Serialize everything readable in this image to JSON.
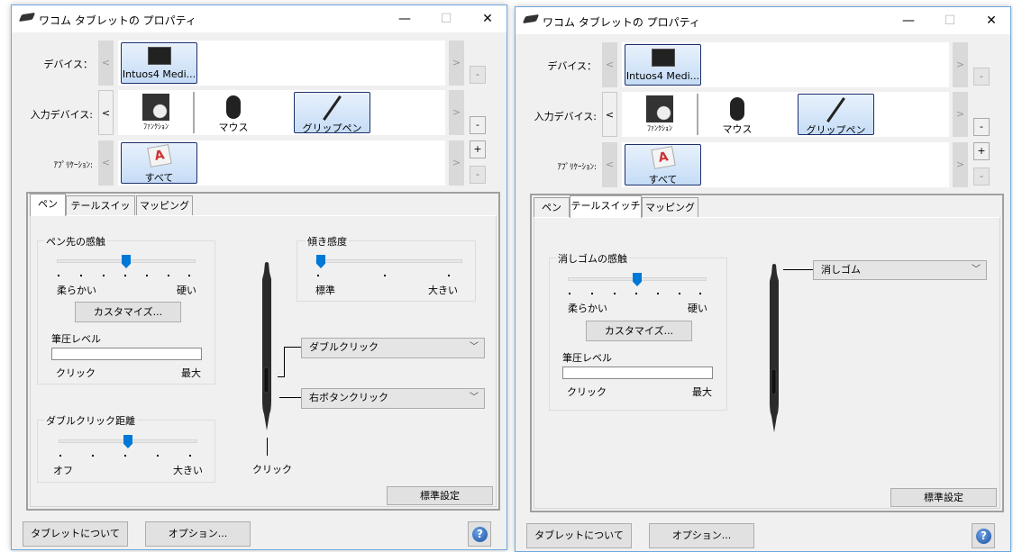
{
  "window_title": "ワコム タブレットの プロパティ",
  "window_controls": {
    "minimize": "—",
    "maximize": "☐",
    "close": "✕"
  },
  "rows": {
    "device_label": "デバイス：",
    "input_label": "入力デバイス:",
    "app_label": "ｱﾌﾟﾘｹｰｼｮﾝ:"
  },
  "nav": {
    "prev": "<",
    "next": ">",
    "plus": "+",
    "minus": "-"
  },
  "devices": [
    {
      "label": "Intuos4 Medi...",
      "selected": true
    }
  ],
  "input_devices": [
    {
      "label": "ﾌｧﾝｸｼｮﾝ"
    },
    {
      "label": "マウス"
    },
    {
      "label": "グリップペン",
      "selected": true
    }
  ],
  "applications": [
    {
      "label": "すべて",
      "selected": true
    }
  ],
  "tabs": [
    "ペン",
    "テールスイッチ",
    "マッピング"
  ],
  "left": {
    "active_tab": "ペン",
    "tip_feel": {
      "title": "ペン先の感触",
      "min": "柔らかい",
      "max": "硬い",
      "value": 4,
      "steps": 7,
      "customize": "カスタマイズ...",
      "pressure_label": "筆圧レベル",
      "pressure_min": "クリック",
      "pressure_max": "最大",
      "pressure_value": 0
    },
    "double_click_distance": {
      "title": "ダブルクリック距離",
      "min": "オフ",
      "max": "大きい",
      "value": 3,
      "steps": 5
    },
    "tilt": {
      "title": "傾き感度",
      "min": "標準",
      "max": "大きい",
      "value": 1,
      "steps": 3
    },
    "upper_button": "ダブルクリック",
    "lower_button": "右ボタンクリック",
    "tip_label": "クリック",
    "default_button": "標準設定"
  },
  "right": {
    "active_tab": "テールスイッチ",
    "eraser_feel": {
      "title": "消しゴムの感触",
      "min": "柔らかい",
      "max": "硬い",
      "value": 4,
      "steps": 7,
      "customize": "カスタマイズ...",
      "pressure_label": "筆圧レベル",
      "pressure_min": "クリック",
      "pressure_max": "最大",
      "pressure_value": 0
    },
    "eraser_function": "消しゴム",
    "default_button": "標準設定"
  },
  "footer": {
    "about": "タブレットについて",
    "options": "オプション...",
    "help": "?"
  },
  "colors": {
    "accent": "#0078d7",
    "selection": "#c5dcf6"
  }
}
